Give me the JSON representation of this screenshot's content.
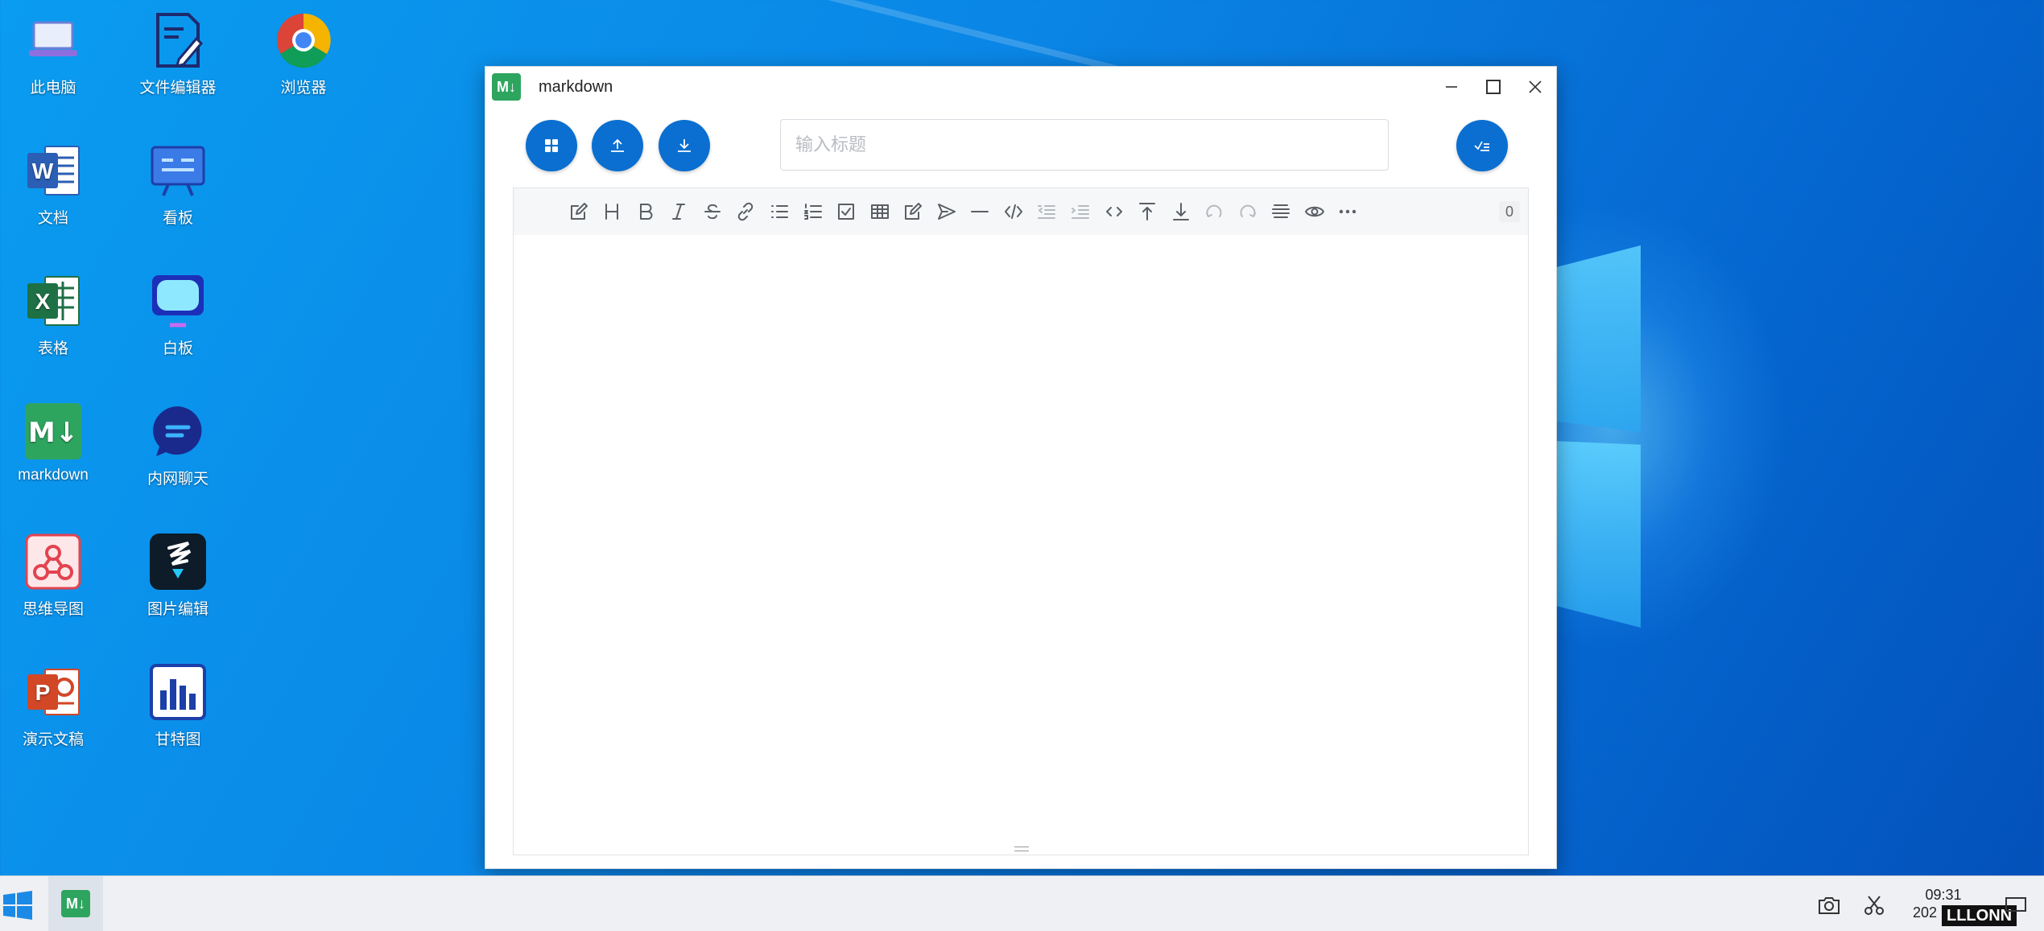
{
  "desktop": {
    "icons": [
      {
        "label": "此电脑",
        "icon": "laptop-icon"
      },
      {
        "label": "文件编辑器",
        "icon": "file-edit-icon"
      },
      {
        "label": "浏览器",
        "icon": "chrome-icon"
      },
      {
        "label": "文档",
        "icon": "word-icon"
      },
      {
        "label": "看板",
        "icon": "kanban-icon"
      },
      {
        "label": "表格",
        "icon": "excel-icon"
      },
      {
        "label": "白板",
        "icon": "whiteboard-icon"
      },
      {
        "label": "markdown",
        "icon": "markdown-icon"
      },
      {
        "label": "内网聊天",
        "icon": "chat-icon"
      },
      {
        "label": "思维导图",
        "icon": "mindmap-icon"
      },
      {
        "label": "图片编辑",
        "icon": "image-edit-icon"
      },
      {
        "label": "演示文稿",
        "icon": "powerpoint-icon"
      },
      {
        "label": "甘特图",
        "icon": "gantt-icon"
      }
    ]
  },
  "window": {
    "badge": "M↓",
    "title": "markdown",
    "title_input_placeholder": "输入标题",
    "title_input_value": "",
    "char_count": "0",
    "toolbar_icons": [
      "edit-icon",
      "heading-icon",
      "bold-icon",
      "italic-icon",
      "strike-icon",
      "link-icon",
      "unordered-list-icon",
      "ordered-list-icon",
      "checklist-icon",
      "table-icon",
      "edit-alt-icon",
      "send-icon",
      "hr-icon",
      "code-icon",
      "outdent-icon",
      "indent-icon",
      "inline-code-icon",
      "to-top-icon",
      "to-bottom-icon",
      "undo-icon",
      "redo-icon",
      "align-icon",
      "preview-icon",
      "more-icon"
    ]
  },
  "taskbar": {
    "clock_time": "09:31",
    "clock_date": "202",
    "watermark": "LLLONN"
  },
  "colors": {
    "accent": "#0a6fd0",
    "markdown_green": "#2ea55f",
    "desktop_blue": "#0a86e6"
  }
}
